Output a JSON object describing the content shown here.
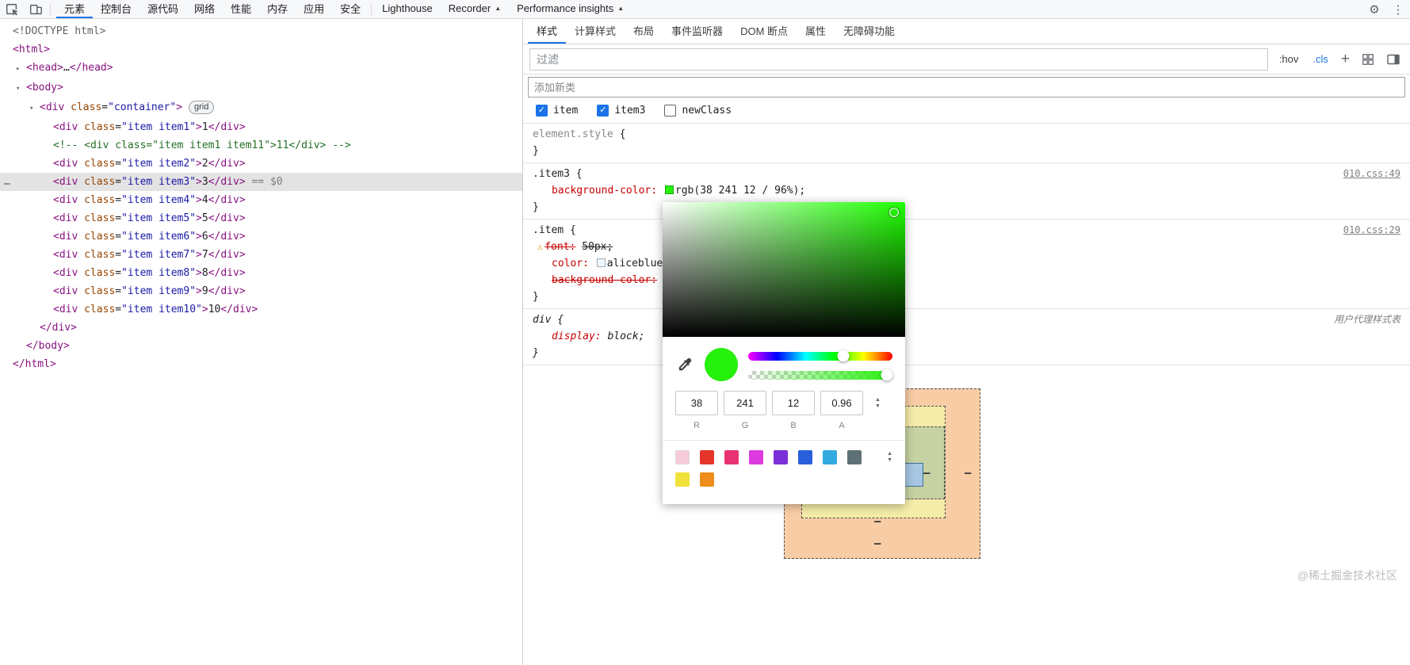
{
  "topbar": {
    "gear_icon": "⚙",
    "kebab_icon": "⋮",
    "tabs": [
      {
        "label": "元素",
        "active": true
      },
      {
        "label": "控制台"
      },
      {
        "label": "源代码"
      },
      {
        "label": "网络"
      },
      {
        "label": "性能"
      },
      {
        "label": "内存"
      },
      {
        "label": "应用"
      },
      {
        "label": "安全"
      },
      {
        "label": "Lighthouse",
        "sep_before": true
      },
      {
        "label": "Recorder",
        "warn": "▲"
      },
      {
        "label": "Performance insights",
        "warn": "▲"
      }
    ]
  },
  "dom_tree": {
    "rows": [
      {
        "level": 0,
        "tokens": [
          [
            "meta",
            "<!DOCTYPE html>"
          ]
        ]
      },
      {
        "level": 0,
        "tokens": [
          [
            "tag",
            "<html>"
          ]
        ]
      },
      {
        "level": 1,
        "arrow": "right",
        "tokens": [
          [
            "tag",
            "<head>"
          ],
          [
            "text",
            "…"
          ],
          [
            "tag",
            "</head>"
          ]
        ]
      },
      {
        "level": 1,
        "arrow": "down",
        "tokens": [
          [
            "tag",
            "<body>"
          ]
        ]
      },
      {
        "level": 2,
        "arrow": "down",
        "tokens": [
          [
            "tag",
            "<div"
          ],
          [
            "attr",
            " class"
          ],
          [
            "punct",
            "="
          ],
          [
            "val",
            "\"container\""
          ],
          [
            "tag",
            ">"
          ],
          [
            "badge",
            "grid"
          ]
        ]
      },
      {
        "level": 3,
        "tokens": [
          [
            "tag",
            "<div"
          ],
          [
            "attr",
            " class"
          ],
          [
            "punct",
            "="
          ],
          [
            "val",
            "\"item item1\""
          ],
          [
            "tag",
            ">"
          ],
          [
            "text",
            "1"
          ],
          [
            "tag",
            "</div>"
          ]
        ]
      },
      {
        "level": 3,
        "tokens": [
          [
            "comment",
            "<!-- <div class=\"item item1 item11\">11</div> -->"
          ]
        ]
      },
      {
        "level": 3,
        "tokens": [
          [
            "tag",
            "<div"
          ],
          [
            "attr",
            " class"
          ],
          [
            "punct",
            "="
          ],
          [
            "val",
            "\"item item2\""
          ],
          [
            "tag",
            ">"
          ],
          [
            "text",
            "2"
          ],
          [
            "tag",
            "</div>"
          ]
        ]
      },
      {
        "level": 3,
        "selected": true,
        "tokens": [
          [
            "tag",
            "<div"
          ],
          [
            "attr",
            " class"
          ],
          [
            "punct",
            "="
          ],
          [
            "val",
            "\"item item3\""
          ],
          [
            "tag",
            ">"
          ],
          [
            "text",
            "3"
          ],
          [
            "tag",
            "</div>"
          ],
          [
            "eq",
            " == $0"
          ]
        ]
      },
      {
        "level": 3,
        "tokens": [
          [
            "tag",
            "<div"
          ],
          [
            "attr",
            " class"
          ],
          [
            "punct",
            "="
          ],
          [
            "val",
            "\"item item4\""
          ],
          [
            "tag",
            ">"
          ],
          [
            "text",
            "4"
          ],
          [
            "tag",
            "</div>"
          ]
        ]
      },
      {
        "level": 3,
        "tokens": [
          [
            "tag",
            "<div"
          ],
          [
            "attr",
            " class"
          ],
          [
            "punct",
            "="
          ],
          [
            "val",
            "\"item item5\""
          ],
          [
            "tag",
            ">"
          ],
          [
            "text",
            "5"
          ],
          [
            "tag",
            "</div>"
          ]
        ]
      },
      {
        "level": 3,
        "tokens": [
          [
            "tag",
            "<div"
          ],
          [
            "attr",
            " class"
          ],
          [
            "punct",
            "="
          ],
          [
            "val",
            "\"item item6\""
          ],
          [
            "tag",
            ">"
          ],
          [
            "text",
            "6"
          ],
          [
            "tag",
            "</div>"
          ]
        ]
      },
      {
        "level": 3,
        "tokens": [
          [
            "tag",
            "<div"
          ],
          [
            "attr",
            " class"
          ],
          [
            "punct",
            "="
          ],
          [
            "val",
            "\"item item7\""
          ],
          [
            "tag",
            ">"
          ],
          [
            "text",
            "7"
          ],
          [
            "tag",
            "</div>"
          ]
        ]
      },
      {
        "level": 3,
        "tokens": [
          [
            "tag",
            "<div"
          ],
          [
            "attr",
            " class"
          ],
          [
            "punct",
            "="
          ],
          [
            "val",
            "\"item item8\""
          ],
          [
            "tag",
            ">"
          ],
          [
            "text",
            "8"
          ],
          [
            "tag",
            "</div>"
          ]
        ]
      },
      {
        "level": 3,
        "tokens": [
          [
            "tag",
            "<div"
          ],
          [
            "attr",
            " class"
          ],
          [
            "punct",
            "="
          ],
          [
            "val",
            "\"item item9\""
          ],
          [
            "tag",
            ">"
          ],
          [
            "text",
            "9"
          ],
          [
            "tag",
            "</div>"
          ]
        ]
      },
      {
        "level": 3,
        "tokens": [
          [
            "tag",
            "<div"
          ],
          [
            "attr",
            " class"
          ],
          [
            "punct",
            "="
          ],
          [
            "val",
            "\"item item10\""
          ],
          [
            "tag",
            ">"
          ],
          [
            "text",
            "10"
          ],
          [
            "tag",
            "</div>"
          ]
        ]
      },
      {
        "level": 2,
        "tokens": [
          [
            "tag",
            "</div>"
          ]
        ]
      },
      {
        "level": 1,
        "tokens": [
          [
            "tag",
            "</body>"
          ]
        ]
      },
      {
        "level": 0,
        "tokens": [
          [
            "tag",
            "</html>"
          ]
        ]
      }
    ]
  },
  "styles": {
    "tabs": [
      {
        "label": "样式",
        "active": true
      },
      {
        "label": "计算样式"
      },
      {
        "label": "布局"
      },
      {
        "label": "事件监听器"
      },
      {
        "label": "DOM 断点"
      },
      {
        "label": "属性"
      },
      {
        "label": "无障碍功能"
      }
    ],
    "filter_placeholder": "过滤",
    "hov_label": ":hov",
    "cls_label": ".cls",
    "plus_label": "+",
    "class_input_placeholder": "添加新类",
    "classes": [
      {
        "label": "item",
        "checked": true
      },
      {
        "label": "item3",
        "checked": true
      },
      {
        "label": "newClass",
        "checked": false
      }
    ],
    "warn_icon": "⚠",
    "open_brace": " {",
    "close_brace": "}",
    "rules": [
      {
        "selector": "element.style",
        "link": ""
      },
      {
        "selector": ".item3",
        "link": "010.css:49",
        "props": [
          {
            "name": "background-color:",
            "value": "rgb(38 241 12 / 96%);",
            "swatch": "#26F10C"
          }
        ]
      },
      {
        "selector": ".item",
        "link": "010.css:29",
        "props": [
          {
            "name": "font:",
            "value": "50px;"
          },
          {
            "name": "color:",
            "value": "aliceblue;",
            "swatch": "#F0F8FF"
          },
          {
            "name": "background-color:",
            "value": ""
          }
        ]
      },
      {
        "selector": "div",
        "link": "用户代理样式表",
        "props": [
          {
            "name": "display:",
            "value": "block;"
          }
        ]
      }
    ]
  },
  "color_picker": {
    "color_hex": "#26F10C",
    "hue_color": "#1EFF00",
    "r": "38",
    "g": "241",
    "b": "12",
    "a": "0.96",
    "labels": [
      "R",
      "G",
      "B",
      "A"
    ],
    "hue_pos_pct": 66,
    "alpha_pos_pct": 96,
    "stepper_up": "▲",
    "stepper_down": "▼",
    "palette_row1": [
      "#F8CBDB",
      "#E5352B",
      "#E93274",
      "#DC3BE0",
      "#7A31D8",
      "#2A5FDB",
      "#33ABE0",
      "#5E7175"
    ],
    "palette_row2": [
      "#F0E23B",
      "#EE8D1C"
    ]
  },
  "page_preview": {
    "dash": "–",
    "outer_color": "#F8CDA6",
    "yellow_color": "#F5ECA9",
    "green_color": "#C6D2A2",
    "blue_color": "#A6C6E2"
  },
  "watermark": "@稀土掘金技术社区"
}
